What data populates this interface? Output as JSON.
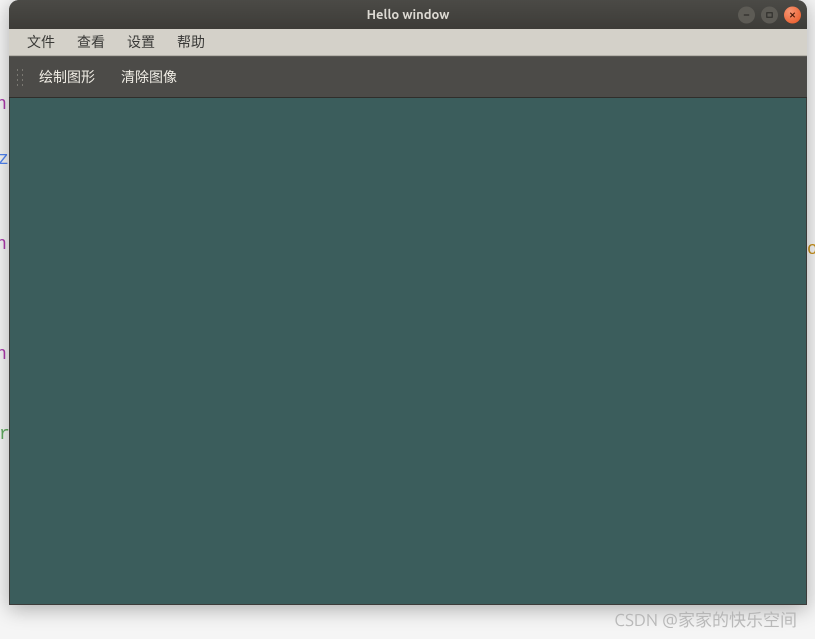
{
  "window": {
    "title": "Hello window"
  },
  "menubar": {
    "items": [
      "文件",
      "查看",
      "设置",
      "帮助"
    ]
  },
  "toolbar": {
    "items": [
      "绘制图形",
      "清除图像"
    ]
  },
  "background_hints": {
    "chars": [
      "n",
      "z",
      "n",
      "n",
      "r"
    ],
    "right_char": "o"
  },
  "watermark": "CSDN @家家的快乐空间"
}
